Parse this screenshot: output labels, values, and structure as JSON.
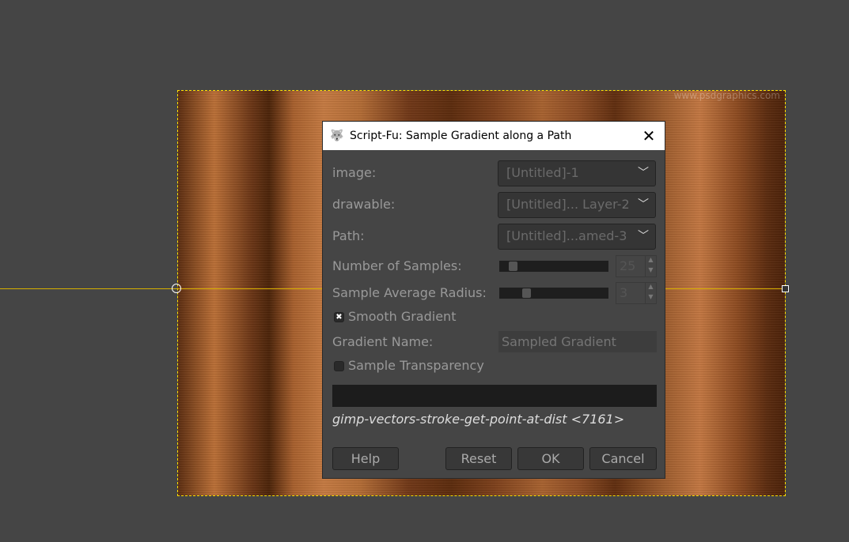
{
  "canvas": {
    "watermark": "www.psdgraphics.com"
  },
  "dialog": {
    "title": "Script-Fu: Sample Gradient along a Path",
    "image_label": "image:",
    "image_value": "[Untitled]-1",
    "drawable_label": "drawable:",
    "drawable_value": "[Untitled]... Layer-2",
    "path_label": "Path:",
    "path_value": "[Untitled]...amed-3",
    "samples_label": "Number of Samples:",
    "samples_value": "25",
    "radius_label": "Sample Average Radius:",
    "radius_value": "3",
    "smooth_label": "Smooth Gradient",
    "smooth_checked": true,
    "gradient_name_label": "Gradient Name:",
    "gradient_name_placeholder": "Sampled Gradient",
    "transparency_label": "Sample Transparency",
    "transparency_checked": false,
    "status_text": "gimp-vectors-stroke-get-point-at-dist <7161>",
    "buttons": {
      "help": "Help",
      "reset": "Reset",
      "ok": "OK",
      "cancel": "Cancel"
    }
  }
}
